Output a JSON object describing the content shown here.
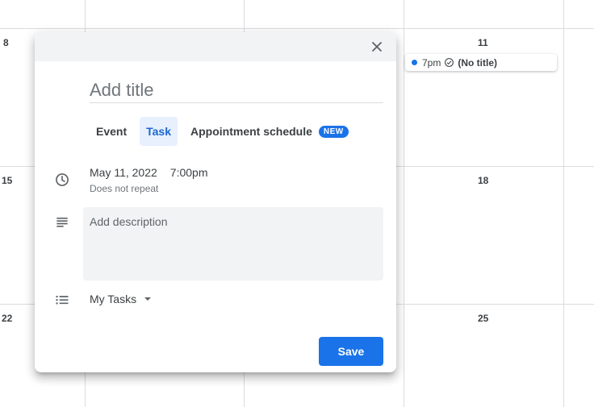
{
  "calendar": {
    "dates": [
      "8",
      "11",
      "15",
      "18",
      "22",
      "25"
    ],
    "event": {
      "time": "7pm",
      "title": "(No title)",
      "color": "#1a73e8"
    }
  },
  "dialog": {
    "title_placeholder": "Add title",
    "tabs": [
      {
        "label": "Event",
        "active": false
      },
      {
        "label": "Task",
        "active": true
      },
      {
        "label": "Appointment schedule",
        "active": false,
        "badge": "NEW"
      }
    ],
    "date": "May 11, 2022",
    "time": "7:00pm",
    "repeat": "Does not repeat",
    "description_placeholder": "Add description",
    "task_list": "My Tasks",
    "save_label": "Save",
    "icons": {
      "close": "close-icon",
      "time": "clock-icon",
      "description": "notes-icon",
      "task_list": "list-icon",
      "dropdown": "caret-down-icon"
    },
    "colors": {
      "accent": "#1a73e8",
      "active_tab_bg": "#e8f0fe",
      "active_tab_text": "#1967d2"
    }
  }
}
